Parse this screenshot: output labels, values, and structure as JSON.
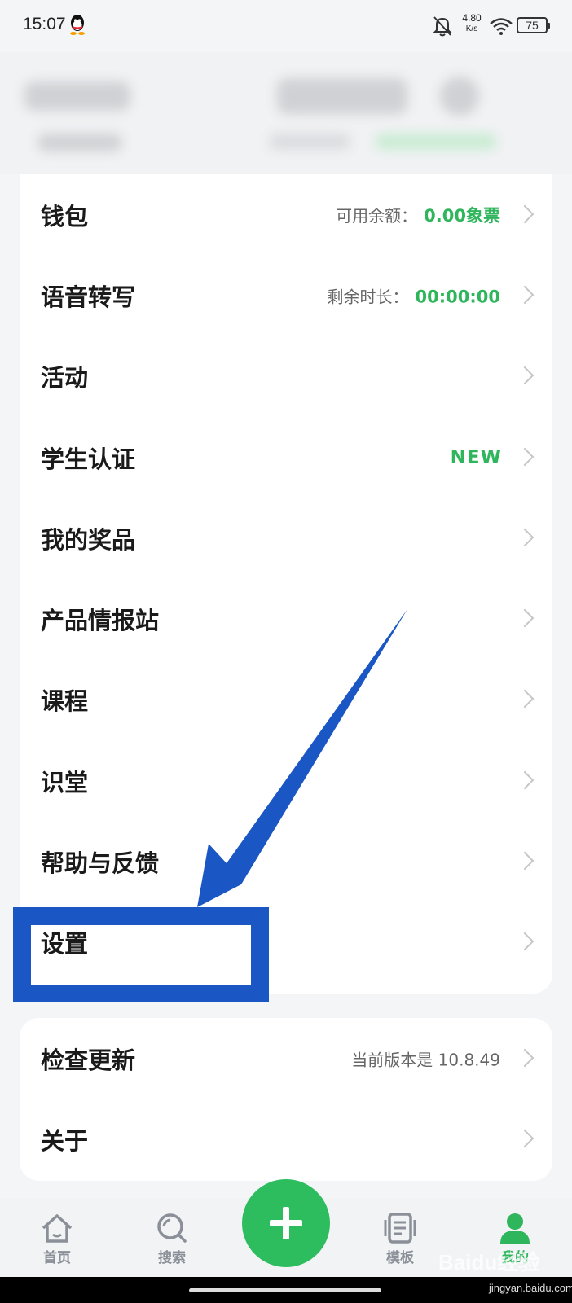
{
  "status_bar": {
    "time": "15:07",
    "net_speed_value": "4.80",
    "net_speed_unit": "K/s",
    "battery": "75"
  },
  "menu": [
    {
      "label": "钱包",
      "extra_label": "可用余额：",
      "extra_value": "0.00象票"
    },
    {
      "label": "语音转写",
      "extra_label": "剩余时长：",
      "extra_value": "00:00:00"
    },
    {
      "label": "活动"
    },
    {
      "label": "学生认证",
      "badge": "NEW"
    },
    {
      "label": "我的奖品"
    },
    {
      "label": "产品情报站"
    },
    {
      "label": "课程"
    },
    {
      "label": "识堂"
    },
    {
      "label": "帮助与反馈"
    },
    {
      "label": "设置"
    }
  ],
  "menu2": [
    {
      "label": "检查更新",
      "extra": "当前版本是 10.8.49"
    },
    {
      "label": "关于"
    }
  ],
  "tabbar": {
    "home": "首页",
    "search": "搜索",
    "templates": "模板",
    "me": "我的"
  },
  "watermark": {
    "brand": "Baidu经验",
    "site": "jingyan.baidu.com"
  },
  "colors": {
    "accent": "#2fb55c",
    "annotation": "#1a56c4"
  }
}
